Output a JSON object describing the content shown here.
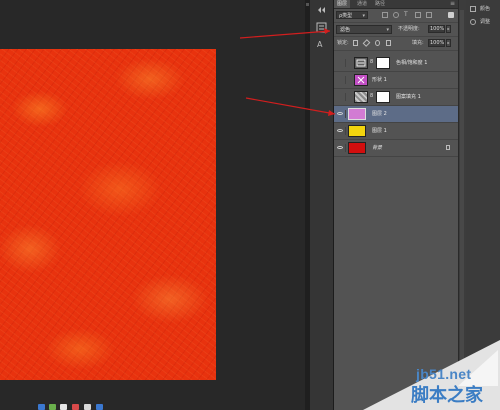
{
  "panel": {
    "tabs": [
      {
        "label": "图层",
        "active": true
      },
      {
        "label": "通道",
        "active": false
      },
      {
        "label": "路径",
        "active": false
      }
    ],
    "filter_kind": "ρ类型",
    "blend_mode": "滤色",
    "opacity_label": "不透明度:",
    "opacity_value": "100%",
    "lock_label": "锁定:",
    "fill_label": "填充:",
    "fill_value": "100%"
  },
  "layers": [
    {
      "name": "色相/饱和度 1",
      "visible": false,
      "thumb": "adjustment-icon",
      "link": "8",
      "has_mask": true,
      "selected": false
    },
    {
      "name": "形状 1",
      "visible": false,
      "thumb_color": "#c24fc4",
      "selected": false
    },
    {
      "name": "图案填充 1",
      "visible": false,
      "thumb": "pattern-icon",
      "link": "8",
      "has_mask": true,
      "selected": false
    },
    {
      "name": "图层 2",
      "visible": true,
      "thumb_color": "#d27bd3",
      "selected": true
    },
    {
      "name": "图层 1",
      "visible": true,
      "thumb_color": "#f2d40e",
      "selected": false
    },
    {
      "name": "背景",
      "visible": true,
      "thumb_color": "#d20e0e",
      "locked": true,
      "selected": false
    }
  ],
  "right_dock": [
    {
      "label": "颜色",
      "icon": "color-icon"
    },
    {
      "label": "调整",
      "icon": "adjust-icon"
    }
  ],
  "watermark": {
    "site": "jb51.net",
    "brand": "脚本之家"
  },
  "colors": {
    "arrow": "#d21e1e",
    "selection": "#5d6c87",
    "canvas_red": "#e8320e",
    "watermark_blue": "#3b7dc4"
  }
}
